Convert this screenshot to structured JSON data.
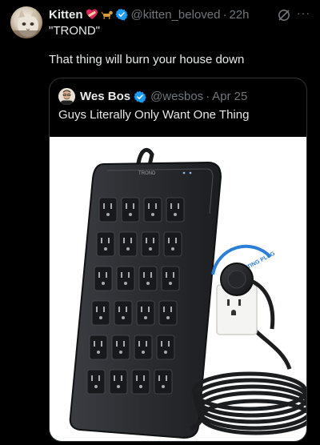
{
  "tweet": {
    "author_name": "Kitten",
    "emoji_icons": [
      "heart-bandage-icon",
      "dog-icon"
    ],
    "handle": "@kitten_beloved",
    "separator": "·",
    "time": "22h",
    "subtitle": "\"TROND\"",
    "text": "That thing will burn your house down",
    "more_label": "···"
  },
  "quoted_tweet": {
    "author_name": "Wes Bos",
    "handle": "@wesbos",
    "separator": "·",
    "date": "Apr 25",
    "text": "Guys Literally Only Want One Thing",
    "image": {
      "brand_text": "TROND",
      "badge_text": "360° ROTATING PLUG"
    }
  },
  "colors": {
    "background": "#000000",
    "text_primary": "#e7e9ea",
    "text_secondary": "#71767b",
    "verified_blue": "#1d9bf0",
    "border": "#2f3336"
  }
}
